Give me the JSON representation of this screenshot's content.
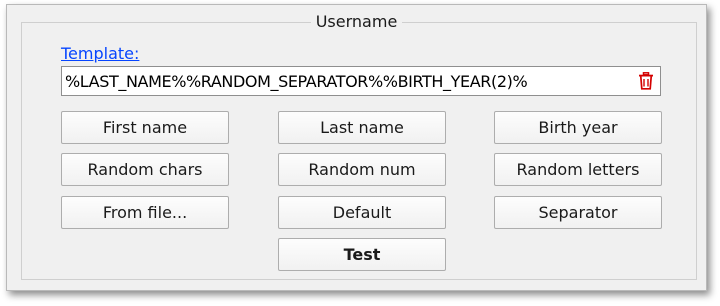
{
  "group": {
    "title": "Username"
  },
  "template": {
    "link_label": "Template:",
    "value": "%LAST_NAME%%RANDOM_SEPARATOR%%BIRTH_YEAR(2)%",
    "clear_icon": "trash-icon"
  },
  "buttons": {
    "first_name": "First name",
    "last_name": "Last name",
    "birth_year": "Birth year",
    "random_chars": "Random chars",
    "random_num": "Random num",
    "random_letters": "Random letters",
    "from_file": "From file...",
    "default": "Default",
    "separator": "Separator",
    "test": "Test"
  },
  "colors": {
    "link": "#0645ff",
    "trash_icon": "#d40000",
    "panel_bg": "#f0f0f0"
  }
}
